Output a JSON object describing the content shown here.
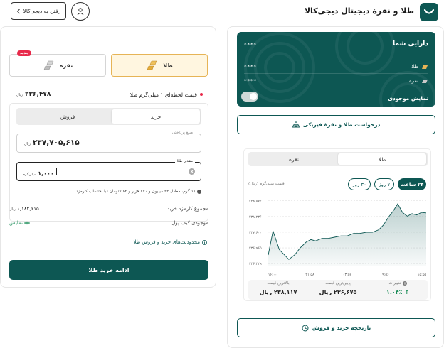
{
  "header": {
    "title": "طلا و نقرهٔ دیجیتال دیجی‌کالا",
    "back_label": "رفتن به دیجی‌کالا"
  },
  "assets": {
    "title": "دارایی شما",
    "total_masked": "****",
    "gold_label": "طلا",
    "gold_masked": "****",
    "silver_label": "نقره",
    "silver_masked": "****",
    "show_balance_label": "نمایش موجودی"
  },
  "physical_request_label": "درخواست طلا و نقرهٔ فیزیکی",
  "chart_panel": {
    "tabs": [
      "طلا",
      "نقره"
    ],
    "active_tab": "طلا",
    "time_ranges": [
      "۲۴ ساعت",
      "۷ روز",
      "۳۰ روز"
    ],
    "active_range": "۲۴ ساعت",
    "price_unit_label": "قیمت میلی‌گرم (ریال)"
  },
  "chart_data": {
    "type": "area",
    "ytick_labels": [
      "۲۳۸,۸۷۲",
      "۲۳۸,۲۳۶",
      "۲۳۷,۶۰۰",
      "۲۳۶,۹۶۵",
      "۲۳۶,۳۲۹"
    ],
    "ytick_values": [
      238872,
      238236,
      237600,
      236965,
      236329
    ],
    "ylim": [
      236250,
      238950
    ],
    "xtick_labels": [
      "۱۶:۰۰",
      "۲۱:۵۸",
      "۰۳:۵۷",
      "۰۹:۵۶",
      "۱۵:۵۵"
    ],
    "x": [
      0,
      0.03,
      0.07,
      0.1,
      0.13,
      0.17,
      0.2,
      0.24,
      0.27,
      0.3,
      0.34,
      0.38,
      0.42,
      0.46,
      0.5,
      0.54,
      0.58,
      0.62,
      0.66,
      0.7,
      0.73,
      0.76,
      0.79,
      0.82,
      0.85,
      0.88,
      0.91,
      0.94,
      0.97,
      1
    ],
    "values": [
      236680,
      237650,
      236900,
      236700,
      236500,
      236700,
      236950,
      237200,
      237300,
      237250,
      237350,
      237350,
      237400,
      237450,
      237450,
      237550,
      237550,
      237600,
      237600,
      237700,
      237900,
      238200,
      238450,
      238750,
      238400,
      238250,
      238350,
      238300,
      238400,
      238380
    ],
    "grid": true
  },
  "stats": {
    "change_label": "تغییرات",
    "change_value": "۱.۰۴٪",
    "low_label": "پایین‌ترین قیمت",
    "low_value": "۲۳۶,۶۷۵ ریال",
    "high_label": "بالاترین قیمت",
    "high_value": "۲۳۸,۱۱۷ ریال"
  },
  "history_label": "تاریخچه خرید و فروش",
  "trade": {
    "gold_label": "طلا",
    "silver_label": "نقره",
    "new_badge": "جدید",
    "price_label": "قیمت لحظه‌ای ۱ میلی‌گرم طلا",
    "price_value": "۲۳۶,۴۷۸",
    "price_unit": "ریال",
    "buy_label": "خرید",
    "sell_label": "فروش",
    "pay_label": "مبلغ پرداختی",
    "pay_value": "۲۳۷,۷۰۵,۶۱۵",
    "pay_unit": "ریال",
    "amount_label": "مقدار طلا",
    "amount_value": "۱,۰۰۰",
    "amount_unit": "میلی‌گرم",
    "hint": "(۱ گرم، معادل ۲۳ میلیون و ۷۷۰ هزار و ۵۶۲ تومان (با احتساب کارمزد",
    "fee_label": "مجموع کارمزد خرید",
    "fee_value": "۱,۱۸۲,۶۱۵",
    "fee_unit": "ریال",
    "wallet_label": "موجودی کیف پول",
    "wallet_show": "نمایش",
    "limits_label": "محدودیت‌های خرید و فروش طلا",
    "submit_label": "ادامه خرید طلا"
  },
  "colors": {
    "brand": "#0d5753",
    "accent_gold": "#e6b456",
    "badge_red": "#e8294a",
    "positive": "#1a8c57"
  }
}
